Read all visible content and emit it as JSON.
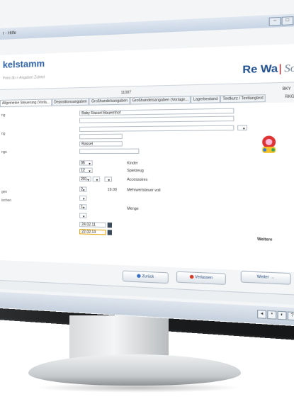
{
  "window": {
    "title": "r - Hilfe"
  },
  "header": {
    "title": "kelstamm",
    "breadcrumb": "Preis äb > Angaben Zuletzt",
    "logo_main": "Re Wa",
    "logo_sep": "|",
    "logo_soft": "Soft"
  },
  "record": {
    "id": "11007",
    "code": "BKY"
  },
  "tabs": [
    "Allgemeine Steuerung (Vorla...",
    "Depositionsangaben",
    "Großhandelsangaben",
    "Großhandelsangaben (Vorlage...",
    "Lagerbestand",
    "Textkurz / Textlangtext"
  ],
  "tabs_extra": "RKG",
  "form": {
    "labels": [
      "ng",
      "ng",
      "ngs",
      "gen",
      "ischen"
    ],
    "name_value": "Baby Rassel Bauernhof",
    "short_value": "Rassel",
    "cat1_value": "05",
    "cat2_value": "12",
    "cat3_value": "201",
    "cat1_text": "Kinder",
    "cat2_text": "Spielzeug",
    "cat3_text": "Accessoires",
    "vat_sel": "2",
    "vat_rate": "19.00",
    "vat_text": "Mehrwertsteuer voll",
    "unit_sel": "1",
    "unit_text": "Menge",
    "date1": "24.02.11",
    "date2": "22.02.13",
    "weiter": "Weitere"
  },
  "buttons": {
    "back": "Zurück",
    "cancel": "Verlassen",
    "next": "Weiter"
  },
  "colors": {
    "accent": "#2e62a8",
    "brand_red": "#c1121c"
  }
}
